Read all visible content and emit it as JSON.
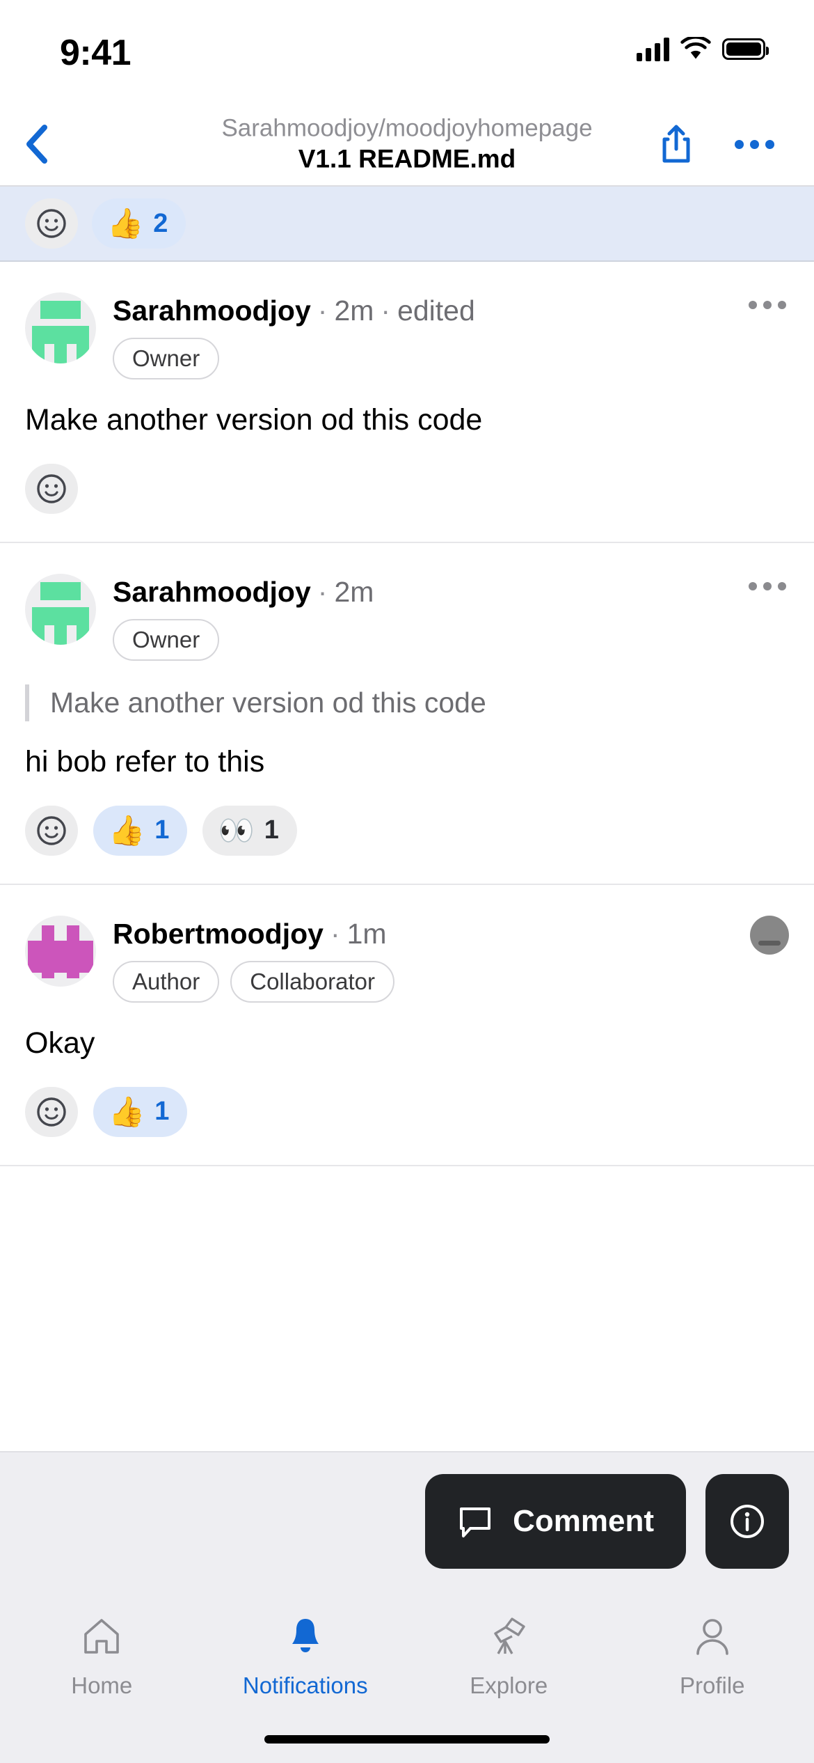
{
  "status_bar": {
    "time": "9:41",
    "icons": [
      "cellular-signal-icon",
      "wifi-icon",
      "battery-icon"
    ]
  },
  "nav_bar": {
    "back_icon": "chevron-left-icon",
    "repo": "Sarahmoodjoy/moodjoyhomepage",
    "file": "V1.1 README.md",
    "share_icon": "share-icon",
    "more_icon": "more-horizontal-icon"
  },
  "header_reactions": {
    "add_reaction_icon": "smiley-face-icon",
    "pills": [
      {
        "emoji": "👍",
        "emoji_name": "thumbs-up",
        "count": "2",
        "selected": true
      }
    ]
  },
  "comments": [
    {
      "author": "Sarahmoodjoy",
      "separator": "·",
      "time": "2m",
      "edited": "edited",
      "badges": [
        "Owner"
      ],
      "avatar_color": "#5ce0a0",
      "avatar_name": "identicon-avatar-sarahmoodjoy",
      "quote": null,
      "body": "Make another version od this code",
      "add_reaction_icon": "smiley-face-icon",
      "reactions": [],
      "menu_icon": "more-horizontal-icon"
    },
    {
      "author": "Sarahmoodjoy",
      "separator": "·",
      "time": "2m",
      "edited": null,
      "badges": [
        "Owner"
      ],
      "avatar_color": "#5ce0a0",
      "avatar_name": "identicon-avatar-sarahmoodjoy",
      "quote": "Make another version od this code",
      "body": "hi bob refer to this",
      "add_reaction_icon": "smiley-face-icon",
      "reactions": [
        {
          "emoji": "👍",
          "emoji_name": "thumbs-up",
          "count": "1",
          "selected": true
        },
        {
          "emoji": "👀",
          "emoji_name": "eyes",
          "count": "1",
          "selected": false
        }
      ],
      "menu_icon": "more-horizontal-icon"
    },
    {
      "author": "Robertmoodjoy",
      "separator": "·",
      "time": "1m",
      "edited": null,
      "badges": [
        "Author",
        "Collaborator"
      ],
      "avatar_color": "#cc55bb",
      "avatar_name": "identicon-avatar-robertmoodjoy",
      "quote": null,
      "body": "Okay",
      "add_reaction_icon": "smiley-face-icon",
      "reactions": [
        {
          "emoji": "👍",
          "emoji_name": "thumbs-up",
          "count": "1",
          "selected": true
        }
      ],
      "menu_icon": "viewer-avatar"
    }
  ],
  "action_bar": {
    "comment_label": "Comment",
    "comment_icon": "speech-bubble-icon",
    "info_icon": "info-circle-icon"
  },
  "tab_bar": {
    "tabs": [
      {
        "label": "Home",
        "icon": "home-icon",
        "active": false
      },
      {
        "label": "Notifications",
        "icon": "bell-icon",
        "active": true
      },
      {
        "label": "Explore",
        "icon": "telescope-icon",
        "active": false
      },
      {
        "label": "Profile",
        "icon": "person-icon",
        "active": false
      }
    ]
  },
  "colors": {
    "accent_blue": "#1268d3",
    "reaction_bar_bg": "#e2e9f7",
    "dark_button": "#212326",
    "tray_bg": "#eeeef2"
  }
}
